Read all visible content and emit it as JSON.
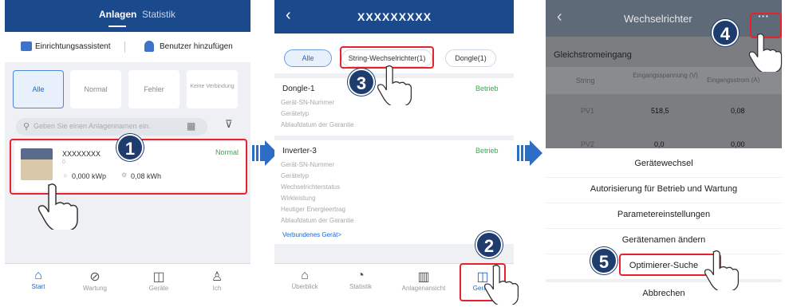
{
  "panel1": {
    "tabs": [
      "Anlagen",
      "Statistik"
    ],
    "actions": [
      "Einrichtungsassistent",
      "Benutzer hinzufügen"
    ],
    "filters": [
      "Alle",
      "Normal",
      "Fehler",
      "Keine Verbindung"
    ],
    "search_placeholder": "Geben Sie einen Anlagennamen ein.",
    "plant": {
      "name": "XXXXXXXX",
      "sub": "0",
      "status": "Normal",
      "power": "0,000 kWp",
      "energy": "0,08 kWh"
    },
    "nav": [
      "Start",
      "Wartung",
      "Geräte",
      "Ich"
    ],
    "step": "1"
  },
  "panel2": {
    "title": "XXXXXXXXX",
    "tabs": [
      "Alle",
      "String-Wechselrichter(1)",
      "Dongle(1)"
    ],
    "device1": {
      "name": "Dongle-1",
      "status": "Betrieb",
      "fields": [
        "Gerät-SN-Nummer",
        "Gerätetyp",
        "Ablaufdatum der Garantie"
      ]
    },
    "device2": {
      "name": "Inverter-3",
      "status": "Betrieb",
      "fields": [
        "Gerät-SN-Nummer",
        "Gerätetyp",
        "Wechselrichterstatus",
        "Wirkleistung",
        "Heutiger Energieertrag",
        "Ablaufdatum der Garantie"
      ],
      "link": "Verbundenes Gerät>"
    },
    "nav": [
      "Überblick",
      "Statistik",
      "Anlagenansicht",
      "Geräte"
    ],
    "steps": [
      "3",
      "2"
    ]
  },
  "panel3": {
    "title": "Wechselrichter",
    "more": "···",
    "section": "Gleichstromeingang",
    "columns": [
      "String",
      "Eingangsspannung (V)",
      "Eingangsstrom (A)"
    ],
    "rows": [
      [
        "PV1",
        "518,5",
        "0,08"
      ],
      [
        "PV2",
        "0,0",
        "0,00"
      ]
    ],
    "menu": [
      "Gerätewechsel",
      "Autorisierung für Betrieb und Wartung",
      "Parametereinstellungen",
      "Gerätenamen ändern",
      "Optimierer-Suche",
      "Abbrechen"
    ],
    "steps": [
      "4",
      "5"
    ]
  },
  "colors": {
    "header": "#1b4a8c",
    "highlight": "#e8222a",
    "accent": "#1a67d2",
    "status_green": "#2fae4a",
    "step_badge": "#1e3d6e"
  }
}
